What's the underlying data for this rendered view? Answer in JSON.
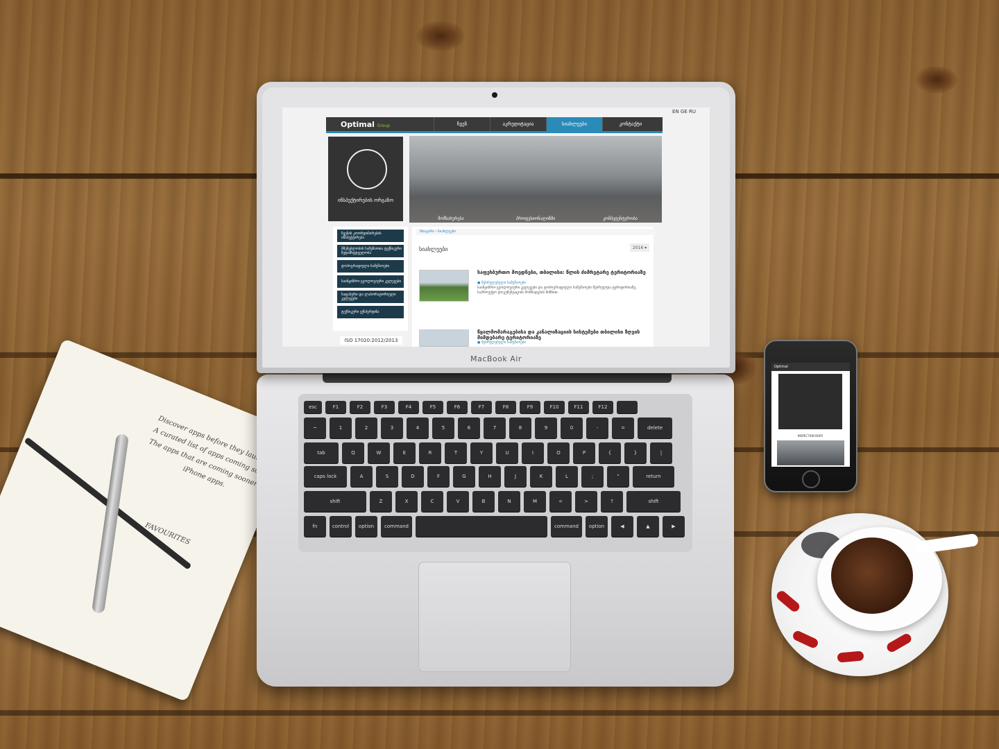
{
  "laptop": {
    "brand_label": "MacBook Air",
    "keys": {
      "row0": [
        "esc",
        "F1",
        "F2",
        "F3",
        "F4",
        "F5",
        "F6",
        "F7",
        "F8",
        "F9",
        "F10",
        "F11",
        "F12",
        ""
      ],
      "row1": [
        "~",
        "1",
        "2",
        "3",
        "4",
        "5",
        "6",
        "7",
        "8",
        "9",
        "0",
        "-",
        "=",
        "delete"
      ],
      "row2": [
        "tab",
        "Q",
        "W",
        "E",
        "R",
        "T",
        "Y",
        "U",
        "I",
        "O",
        "P",
        "{",
        "}",
        "|"
      ],
      "row3": [
        "caps lock",
        "A",
        "S",
        "D",
        "F",
        "G",
        "H",
        "J",
        "K",
        "L",
        ";",
        "\"",
        "return"
      ],
      "row4": [
        "shift",
        "Z",
        "X",
        "C",
        "V",
        "B",
        "N",
        "M",
        "<",
        ">",
        "?",
        "shift"
      ],
      "row5": [
        "fn",
        "control",
        "option",
        "command",
        "",
        "command",
        "option",
        "◀",
        "▲",
        "▶"
      ]
    }
  },
  "website": {
    "lang_switch": "EN GE RU",
    "logo": {
      "name": "Optimal",
      "suffix": "Group"
    },
    "nav": [
      "ჩვენ",
      "აკრედიტაცია",
      "სიახლეები",
      "კონტაქტი"
    ],
    "logo_caption": "ინსპექტირების ორგანო",
    "hero_captions": [
      "მომსახურება",
      "პროფესიონალიზმი",
      "კომპეტენტურობა"
    ],
    "sidebar_buttons": [
      "ჩვენის კოორდინირების ინსპექტირება",
      "მშენებლობის სამუშაოთა ტექნიკური ზედამხედველობა",
      "ტოპოგრაფიული სამუშაოები",
      "საინჟინრო-გეოლოგიური კვლევები",
      "საფასური და ლაბორატორიული კვლევები",
      "ტექნიკური ექსპერტიზა"
    ],
    "iso": "ISO 17020:2012/2013",
    "breadcrumb": "მთავარი  ›  სიახლეები",
    "section_title": "სიახლეები",
    "year_select": "2016 ▾",
    "news": [
      {
        "title": "საფეხბურთო მოედნები, თბილისი: წლის ძიმრეტარე ტერიტორიაზე",
        "meta": "● შესრულებული სამუშაოები",
        "text": "საინჟინრო-გეოლოგიური კვლევები და ტოპოგრაფიული სამუშაოები შესრულდა ტერიტორიაზე, საპროექტო დოკუმენტაციის მომზადების მიზნით."
      },
      {
        "title": "წყალმომარაგებისა და კანალიზაციის სისტემები  თბილისი ზღვის მიმდებარე ტერიტორიაზე",
        "meta": "● შესრულებული სამუშაოები",
        "text": ""
      }
    ]
  },
  "phone": {
    "nav_label": "Optimal",
    "logo_caption": "INSPECTION BODY"
  },
  "notebook": {
    "lines": [
      "Discover apps before they launch.",
      "A curated list of apps coming soon.",
      "The apps that are coming sooner",
      "iPhone apps.",
      "FAVOURITES"
    ]
  },
  "colors": {
    "accent": "#2a8ab8",
    "nav_dark": "#3a3a3a",
    "sidebar_btn": "#1c3a4a"
  }
}
